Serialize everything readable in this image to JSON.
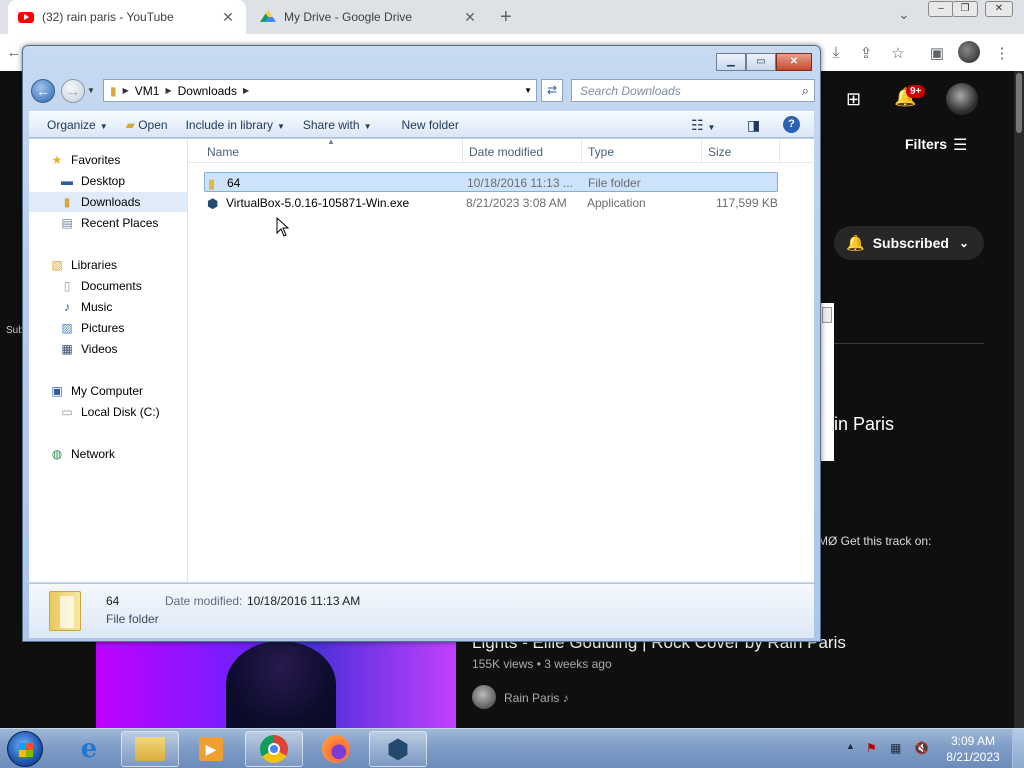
{
  "browser": {
    "tabs": [
      {
        "title": "(32) rain paris - YouTube",
        "active": true,
        "icon": "youtube-icon"
      },
      {
        "title": "My Drive - Google Drive",
        "active": false,
        "icon": "google-drive-icon"
      }
    ],
    "new_tab": "+",
    "close_glyph": "✕"
  },
  "youtube": {
    "notification_count": "9+",
    "filters_label": "Filters",
    "subscribed_label": "Subscribed",
    "left_fragment": "Sub",
    "channel_heading_fragment": "in Paris",
    "description_fragment": "t. MØ Get this track on:",
    "video": {
      "title": "Lights - Ellie Goulding | Rock Cover by Rain Paris",
      "meta": "155K views • 3 weeks ago",
      "channel": "Rain Paris",
      "music_note": "♪"
    }
  },
  "explorer": {
    "breadcrumb": [
      "VM1",
      "Downloads"
    ],
    "search_placeholder": "Search Downloads",
    "commands": {
      "organize": "Organize",
      "open": "Open",
      "include_in_library": "Include in library",
      "share_with": "Share with",
      "new_folder": "New folder"
    },
    "nav": {
      "favorites": "Favorites",
      "desktop": "Desktop",
      "downloads": "Downloads",
      "recent_places": "Recent Places",
      "libraries": "Libraries",
      "documents": "Documents",
      "music": "Music",
      "pictures": "Pictures",
      "videos": "Videos",
      "computer": "My Computer",
      "local_disk": "Local Disk (C:)",
      "network": "Network"
    },
    "columns": {
      "name": "Name",
      "date_modified": "Date modified",
      "type": "Type",
      "size": "Size"
    },
    "files": [
      {
        "name": "64",
        "date": "10/18/2016 11:13 ...",
        "type": "File folder",
        "size": "",
        "selected": true
      },
      {
        "name": "VirtualBox-5.0.16-105871-Win.exe",
        "date": "8/21/2023 3:08 AM",
        "type": "Application",
        "size": "117,599 KB",
        "selected": false
      }
    ],
    "details": {
      "name": "64",
      "type": "File folder",
      "date_label": "Date modified:",
      "date_value": "10/18/2016 11:13 AM"
    }
  },
  "taskbar": {
    "clock_time": "3:09 AM",
    "clock_date": "8/21/2023"
  }
}
